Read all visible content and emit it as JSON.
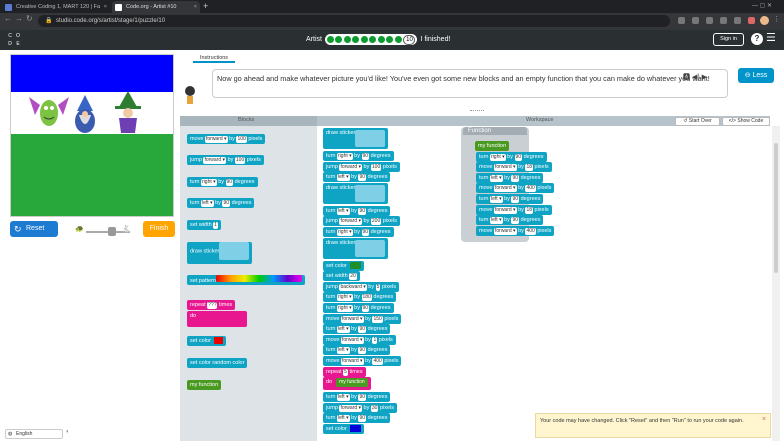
{
  "browser": {
    "tabs": [
      {
        "label": "Creative Coding 1, MART 120 | Fa",
        "close": "×"
      },
      {
        "label": "Code.org - Artist #10",
        "close": "×"
      }
    ],
    "new_tab": "+",
    "url": "studio.code.org/s/artist/stage/1/puzzle/10"
  },
  "header": {
    "logo_letters": [
      "C",
      "O",
      "D",
      "E"
    ],
    "title": "Artist",
    "level": "10",
    "finished_text": "I finished!",
    "signin": "Sign in",
    "help": "?",
    "menu": "☰"
  },
  "left": {
    "reset": "Reset",
    "finish": "Finish",
    "speed_slow_icon": "turtle-icon",
    "speed_fast_icon": "rabbit-icon",
    "speed_level": 0.6,
    "language": "English",
    "canvas_colors": {
      "top": "#0000ff",
      "middle": "#ffffff",
      "bottom": "#28a83a"
    }
  },
  "instructions": {
    "tab": "Instructions",
    "text": "Now go ahead and make whatever picture you'd like! You've even got some new blocks and an empty function that you can make do whatever you want!",
    "less": "Less"
  },
  "toolbar": {
    "blocks_label": "Blocks",
    "workspace_label": "Workspace",
    "start_over": "Start Over",
    "show_code": "Show Code"
  },
  "toolbox": [
    {
      "pre": "move",
      "chip": "forward ▾",
      "mid": "by",
      "num": "100",
      "post": "pixels"
    },
    {
      "pre": "jump",
      "chip": "forward ▾",
      "mid": "by",
      "num": "100",
      "post": "pixels"
    },
    {
      "pre": "turn",
      "chip": "right ▾",
      "mid": "by",
      "num": "90",
      "post": "degrees"
    },
    {
      "pre": "turn",
      "chip": "left ▾",
      "mid": "by",
      "num": "90",
      "post": "degrees"
    },
    {
      "pre": "set width",
      "chip": "",
      "mid": "",
      "num": "1",
      "post": ""
    },
    {
      "pre": "draw sticker",
      "chip": "",
      "mid": "",
      "num": "",
      "post": ""
    },
    {
      "pre": "set pattern",
      "chip": "",
      "mid": "",
      "num": "",
      "post": ""
    },
    {
      "pre": "repeat",
      "chip": "",
      "mid": "",
      "num": "???",
      "post": "times"
    },
    {
      "pre": "set color",
      "chip": "",
      "mid": "",
      "num": "",
      "post": ""
    },
    {
      "pre": "set color",
      "chip": "",
      "mid": "",
      "num": "",
      "post": "random color"
    },
    {
      "pre": "my function",
      "chip": "",
      "mid": "",
      "num": "",
      "post": ""
    }
  ],
  "toolbox_do": "do",
  "workspace_main": [
    {
      "pre": "draw sticker",
      "chip": "",
      "num": "",
      "post": "",
      "kind": "sticker"
    },
    {
      "pre": "turn",
      "chip": "right ▾",
      "num": "90",
      "post": "degrees"
    },
    {
      "pre": "jump",
      "chip": "forward ▾",
      "num": "100",
      "post": "pixels"
    },
    {
      "pre": "turn",
      "chip": "left ▾",
      "num": "90",
      "post": "degrees"
    },
    {
      "pre": "draw sticker",
      "chip": "",
      "num": "",
      "post": "",
      "kind": "sticker"
    },
    {
      "pre": "turn",
      "chip": "left ▾",
      "num": "90",
      "post": "degrees"
    },
    {
      "pre": "jump",
      "chip": "forward ▾",
      "num": "200",
      "post": "pixels"
    },
    {
      "pre": "turn",
      "chip": "right ▾",
      "num": "90",
      "post": "degrees"
    },
    {
      "pre": "draw sticker",
      "chip": "",
      "num": "",
      "post": "",
      "kind": "sticker"
    },
    {
      "pre": "set color",
      "chip": "",
      "num": "",
      "post": "",
      "kind": "color",
      "color": "#1f8f2a"
    },
    {
      "pre": "set width",
      "chip": "",
      "num": "20",
      "post": ""
    },
    {
      "pre": "jump",
      "chip": "backward ▾",
      "num": "5",
      "post": "pixels"
    },
    {
      "pre": "turn",
      "chip": "right ▾",
      "num": "180",
      "post": "degrees"
    },
    {
      "pre": "turn",
      "chip": "right ▾",
      "num": "90",
      "post": "degrees"
    },
    {
      "pre": "move",
      "chip": "forward ▾",
      "num": "150",
      "post": "pixels"
    },
    {
      "pre": "turn",
      "chip": "left ▾",
      "num": "90",
      "post": "degrees"
    },
    {
      "pre": "move",
      "chip": "forward ▾",
      "num": "1",
      "post": "pixels"
    },
    {
      "pre": "turn",
      "chip": "left ▾",
      "num": "90",
      "post": "degrees"
    },
    {
      "pre": "move",
      "chip": "forward ▾",
      "num": "400",
      "post": "pixels"
    },
    {
      "pre": "repeat",
      "chip": "",
      "num": "5",
      "post": "times",
      "kind": "repeat"
    },
    {
      "pre": "do",
      "chip": "",
      "num": "",
      "post": "",
      "kind": "do",
      "inner": "my function"
    },
    {
      "pre": "turn",
      "chip": "left ▾",
      "num": "90",
      "post": "degrees"
    },
    {
      "pre": "jump",
      "chip": "forward ▾",
      "num": "30",
      "post": "pixels"
    },
    {
      "pre": "turn",
      "chip": "left ▾",
      "num": "90",
      "post": "degrees"
    },
    {
      "pre": "set color",
      "chip": "",
      "num": "",
      "post": "",
      "kind": "color",
      "color": "#0000dd"
    }
  ],
  "function": {
    "title": "Function",
    "name": "my function",
    "blocks": [
      {
        "pre": "turn",
        "chip": "right ▾",
        "num": "90",
        "post": "degrees"
      },
      {
        "pre": "move",
        "chip": "forward ▾",
        "num": "18",
        "post": "pixels"
      },
      {
        "pre": "turn",
        "chip": "left ▾",
        "num": "90",
        "post": "degrees"
      },
      {
        "pre": "move",
        "chip": "forward ▾",
        "num": "400",
        "post": "pixels"
      },
      {
        "pre": "turn",
        "chip": "left ▾",
        "num": "90",
        "post": "degrees"
      },
      {
        "pre": "move",
        "chip": "forward ▾",
        "num": "18",
        "post": "pixels"
      },
      {
        "pre": "turn",
        "chip": "left ▾",
        "num": "90",
        "post": "degrees"
      },
      {
        "pre": "move",
        "chip": "forward ▾",
        "num": "400",
        "post": "pixels"
      }
    ]
  },
  "toast": {
    "text": "Your code may have changed. Click \"Reset\" and then \"Run\" to run your code again.",
    "close": "×"
  }
}
